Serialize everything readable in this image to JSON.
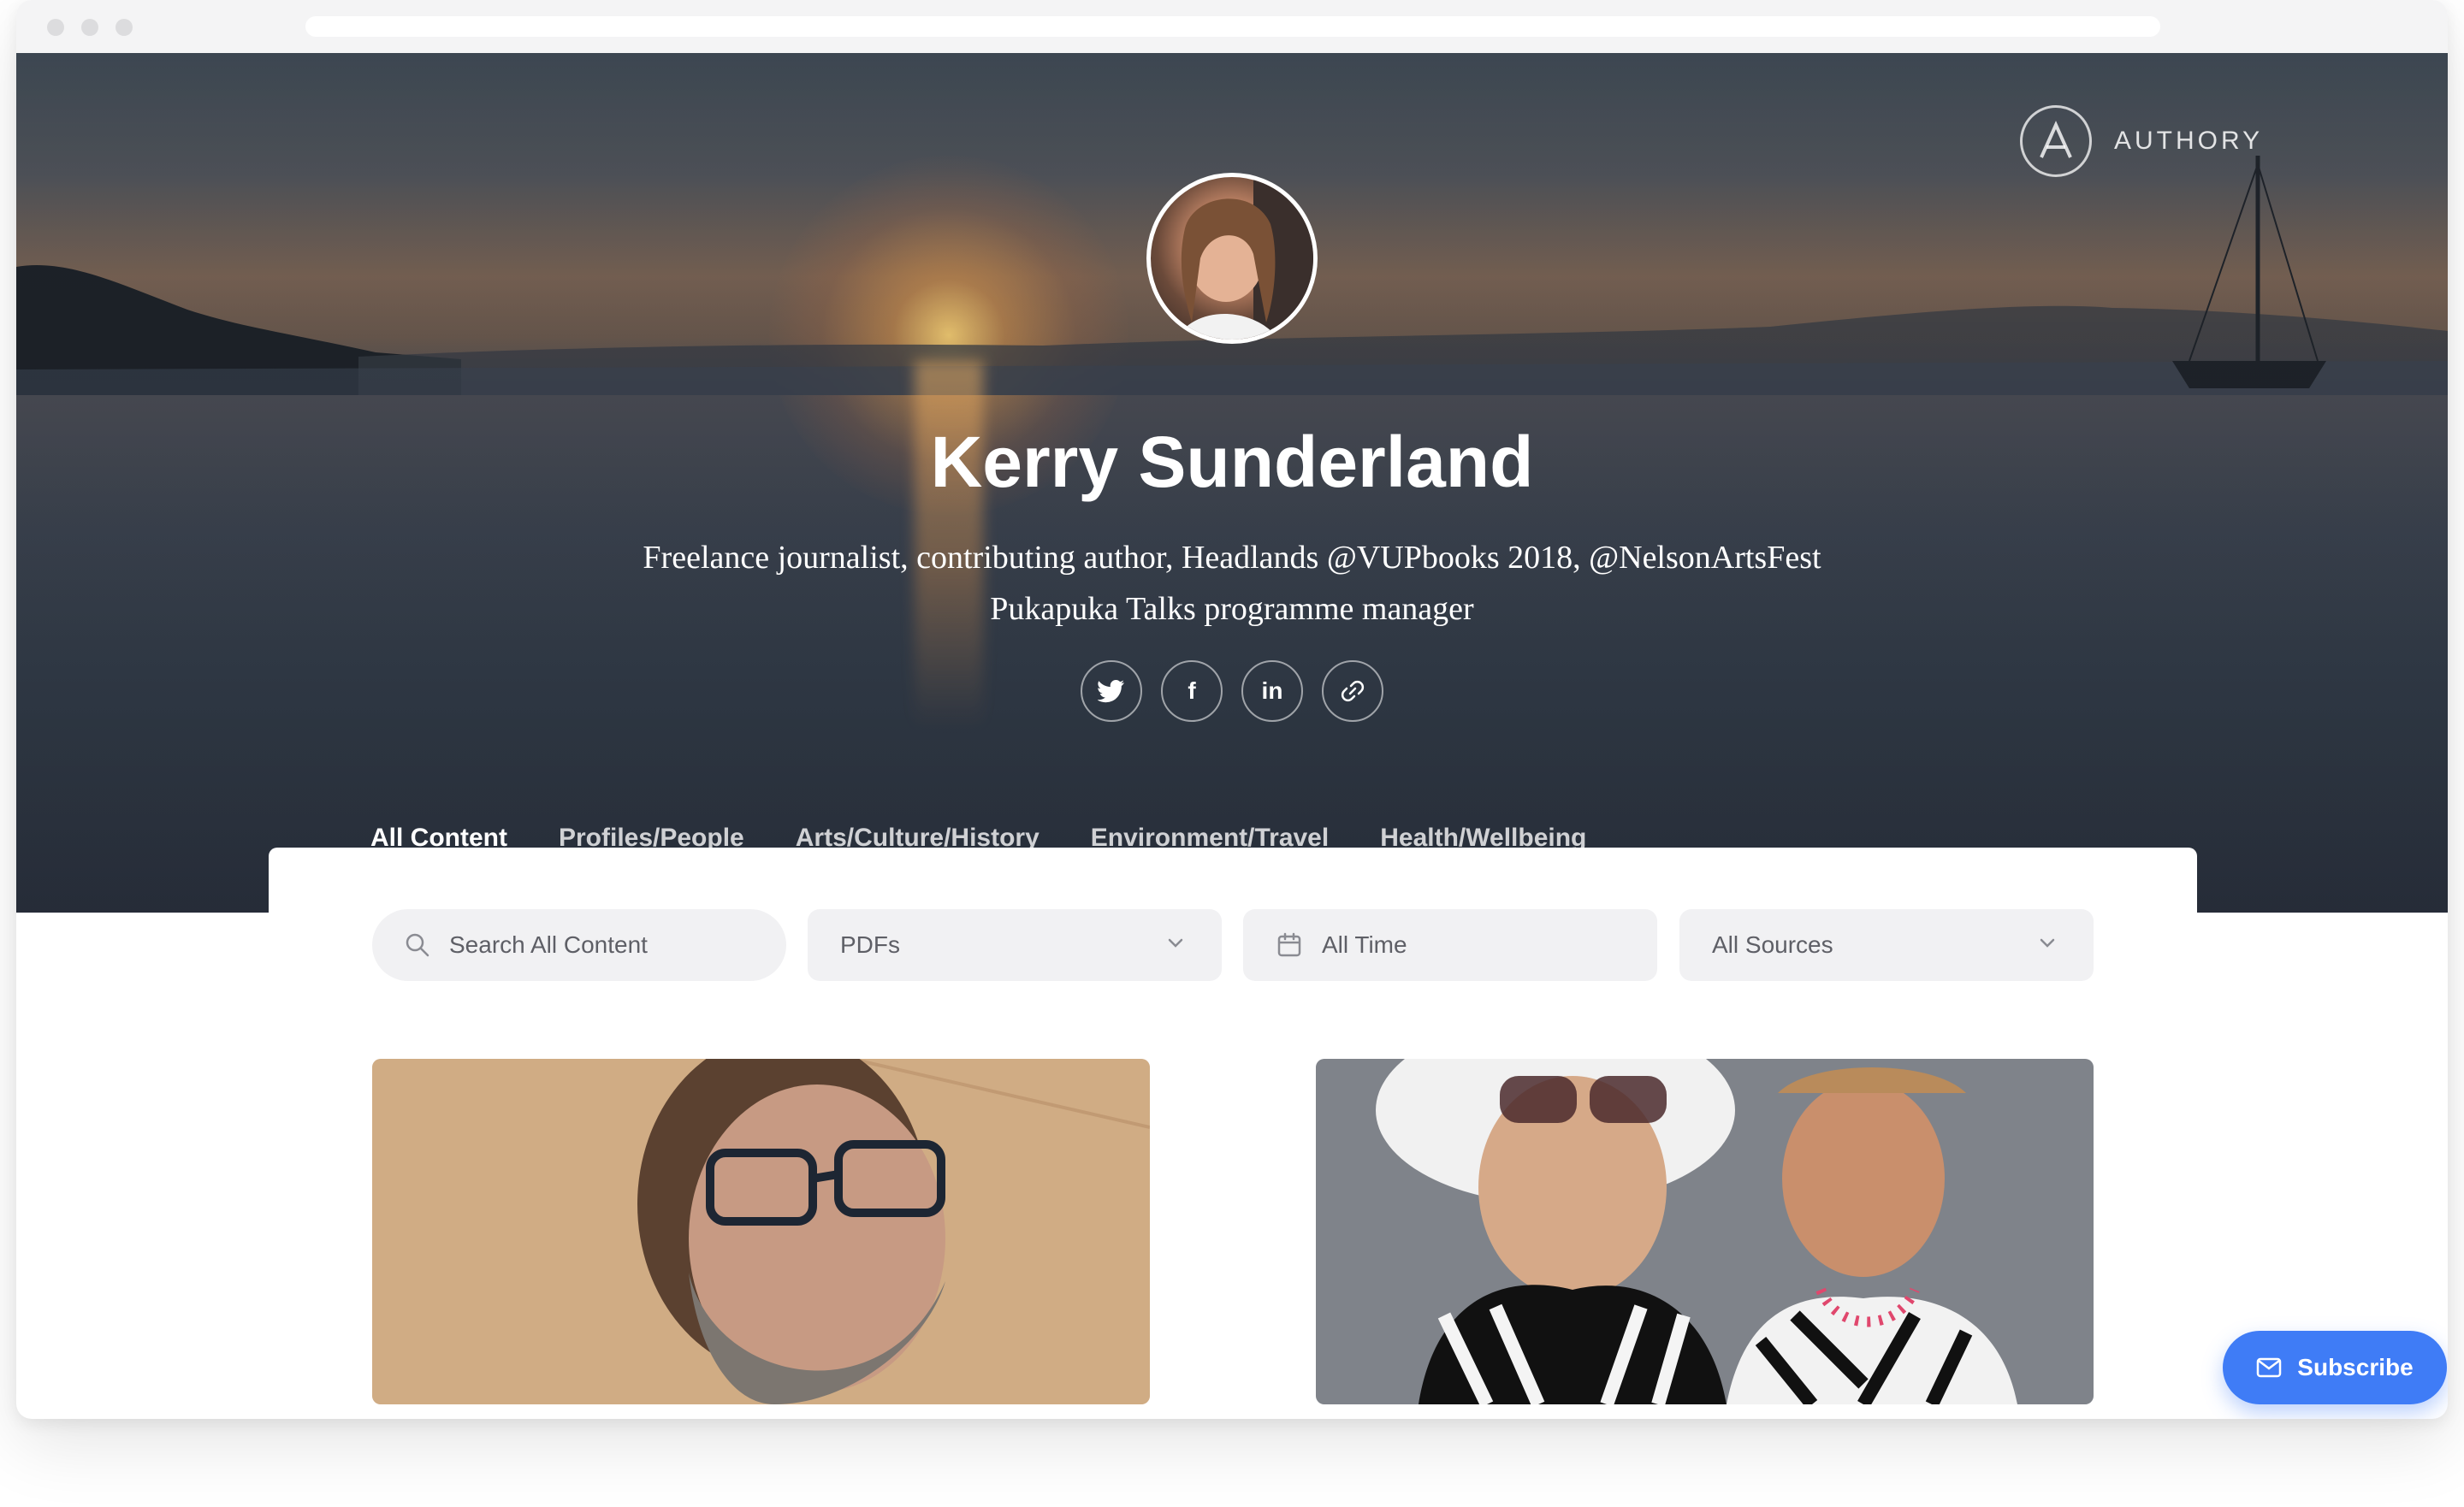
{
  "brand": {
    "name": "AUTHORY"
  },
  "profile": {
    "name": "Kerry Sunderland",
    "bio_line1": "Freelance journalist, contributing author, Headlands @VUPbooks 2018, @NelsonArtsFest",
    "bio_line2": "Pukapuka Talks programme manager"
  },
  "social": {
    "twitter": "twitter-icon",
    "facebook_glyph": "f",
    "linkedin_glyph": "in",
    "website": "link-icon"
  },
  "tabs": [
    {
      "label": "All Content",
      "active": true
    },
    {
      "label": "Profiles/People"
    },
    {
      "label": "Arts/Culture/History"
    },
    {
      "label": "Environment/Travel"
    },
    {
      "label": "Health/Wellbeing"
    }
  ],
  "filters": {
    "search_placeholder": "Search All Content",
    "type_value": "PDFs",
    "time_value": "All Time",
    "source_value": "All Sources"
  },
  "subscribe": {
    "label": "Subscribe"
  },
  "colors": {
    "accent": "#3f7cf6",
    "filter_bg": "#f1f1f3"
  }
}
